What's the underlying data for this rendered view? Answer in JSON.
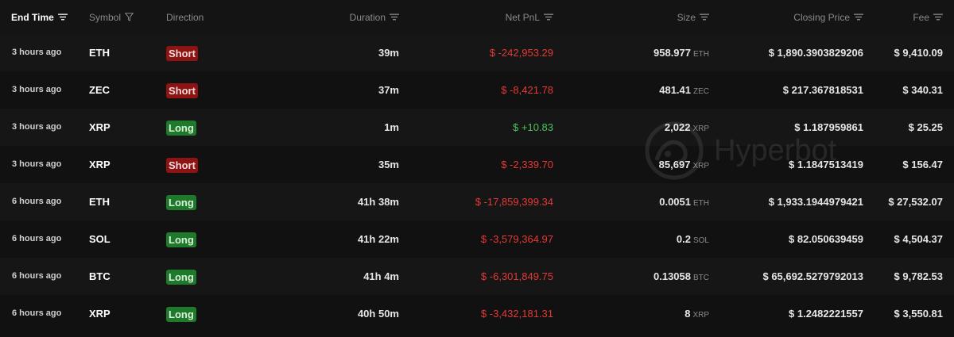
{
  "header": {
    "end_time": "End Time",
    "symbol": "Symbol",
    "direction": "Direction",
    "duration": "Duration",
    "net_pnl": "Net PnL",
    "size": "Size",
    "closing_price": "Closing Price",
    "fee": "Fee"
  },
  "watermark": {
    "text": "Hyperbot"
  },
  "colors": {
    "short": "#8e1414",
    "long": "#1e7a2a",
    "negative": "#e53935",
    "positive": "#4cc25a"
  },
  "icons": {
    "sort": "sort-lines-icon",
    "filter": "funnel-filter-icon"
  },
  "rows": [
    {
      "end_time": "3 hours ago",
      "symbol": "ETH",
      "direction": "Short",
      "duration": "39m",
      "net_pnl": "$ -242,953.29",
      "pnl_sign": "neg",
      "size": "958.977",
      "size_unit": "ETH",
      "closing_price": "$ 1,890.3903829206",
      "fee": "$ 9,410.09"
    },
    {
      "end_time": "3 hours ago",
      "symbol": "ZEC",
      "direction": "Short",
      "duration": "37m",
      "net_pnl": "$ -8,421.78",
      "pnl_sign": "neg",
      "size": "481.41",
      "size_unit": "ZEC",
      "closing_price": "$ 217.367818531",
      "fee": "$ 340.31"
    },
    {
      "end_time": "3 hours ago",
      "symbol": "XRP",
      "direction": "Long",
      "duration": "1m",
      "net_pnl": "$ +10.83",
      "pnl_sign": "pos",
      "size": "2,022",
      "size_unit": "XRP",
      "closing_price": "$ 1.187959861",
      "fee": "$ 25.25"
    },
    {
      "end_time": "3 hours ago",
      "symbol": "XRP",
      "direction": "Short",
      "duration": "35m",
      "net_pnl": "$ -2,339.70",
      "pnl_sign": "neg",
      "size": "85,697",
      "size_unit": "XRP",
      "closing_price": "$ 1.1847513419",
      "fee": "$ 156.47"
    },
    {
      "end_time": "6 hours ago",
      "symbol": "ETH",
      "direction": "Long",
      "duration": "41h 38m",
      "net_pnl": "$ -17,859,399.34",
      "pnl_sign": "neg",
      "size": "0.0051",
      "size_unit": "ETH",
      "closing_price": "$ 1,933.1944979421",
      "fee": "$ 27,532.07"
    },
    {
      "end_time": "6 hours ago",
      "symbol": "SOL",
      "direction": "Long",
      "duration": "41h 22m",
      "net_pnl": "$ -3,579,364.97",
      "pnl_sign": "neg",
      "size": "0.2",
      "size_unit": "SOL",
      "closing_price": "$ 82.050639459",
      "fee": "$ 4,504.37"
    },
    {
      "end_time": "6 hours ago",
      "symbol": "BTC",
      "direction": "Long",
      "duration": "41h 4m",
      "net_pnl": "$ -6,301,849.75",
      "pnl_sign": "neg",
      "size": "0.13058",
      "size_unit": "BTC",
      "closing_price": "$ 65,692.5279792013",
      "fee": "$ 9,782.53"
    },
    {
      "end_time": "6 hours ago",
      "symbol": "XRP",
      "direction": "Long",
      "duration": "40h 50m",
      "net_pnl": "$ -3,432,181.31",
      "pnl_sign": "neg",
      "size": "8",
      "size_unit": "XRP",
      "closing_price": "$ 1.2482221557",
      "fee": "$ 3,550.81"
    }
  ]
}
